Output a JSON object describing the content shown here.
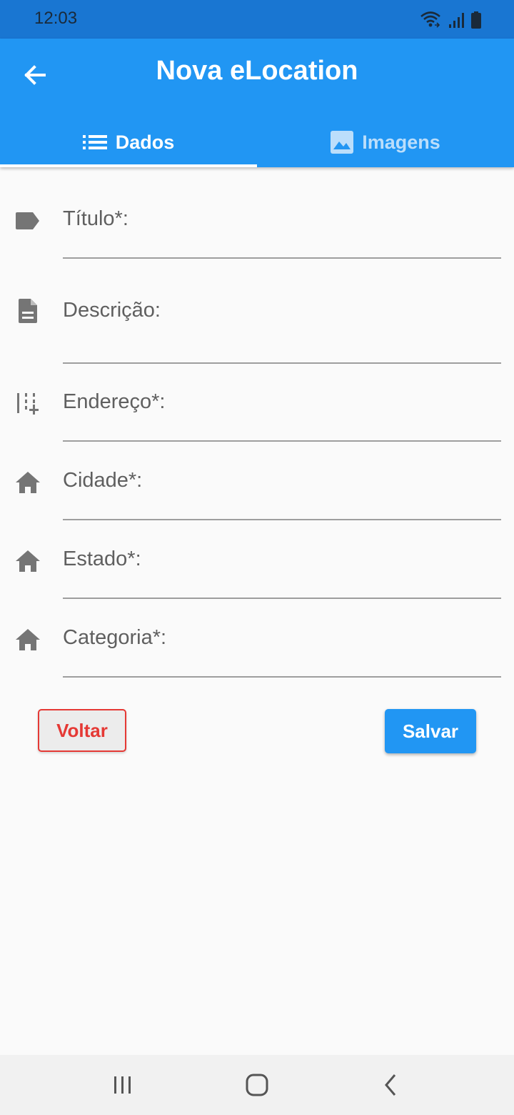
{
  "status_bar": {
    "time": "12:03",
    "icons": [
      "wifi-icon",
      "signal-icon",
      "battery-icon"
    ]
  },
  "app_bar": {
    "title": "Nova eLocation",
    "back_icon": "arrow-back-icon",
    "tabs": [
      {
        "label": "Dados",
        "icon": "list-icon",
        "active": true
      },
      {
        "label": "Imagens",
        "icon": "image-icon",
        "active": false
      }
    ]
  },
  "form": {
    "fields": [
      {
        "label": "Título*:",
        "icon": "label-tag-icon",
        "value": ""
      },
      {
        "label": "Descrição:",
        "icon": "description-icon",
        "value": ""
      },
      {
        "label": "Endereço*:",
        "icon": "address-grid-icon",
        "value": ""
      },
      {
        "label": "Cidade*:",
        "icon": "home-icon",
        "value": ""
      },
      {
        "label": "Estado*:",
        "icon": "home-icon",
        "value": ""
      },
      {
        "label": "Categoria*:",
        "icon": "home-icon",
        "value": ""
      }
    ]
  },
  "actions": {
    "back_label": "Voltar",
    "save_label": "Salvar"
  },
  "nav_bar": {
    "buttons": [
      "recent-apps-icon",
      "home-nav-icon",
      "back-nav-icon"
    ]
  },
  "colors": {
    "primary": "#2196f3",
    "status_bar": "#1976d2",
    "danger": "#e53935",
    "icon_grey": "#757575"
  }
}
